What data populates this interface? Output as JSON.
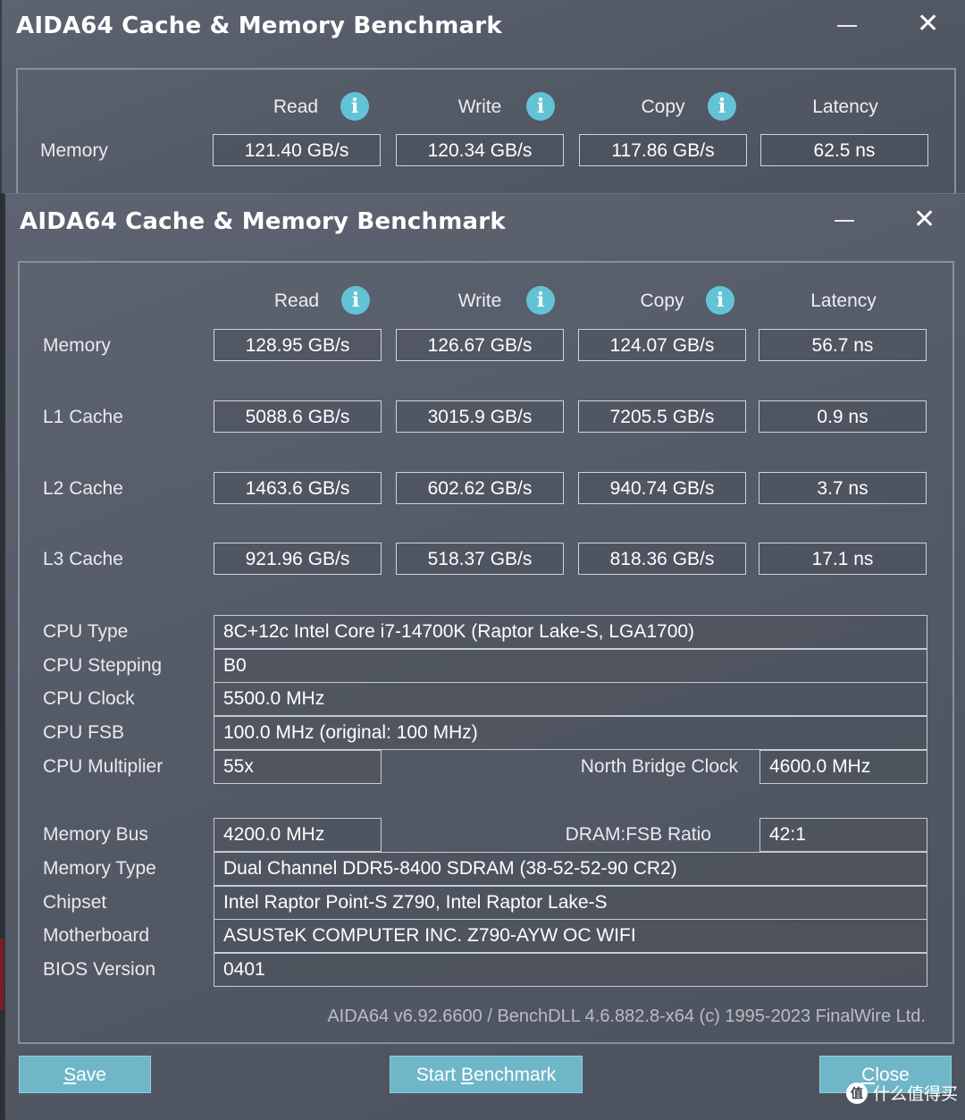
{
  "back_window": {
    "title": "AIDA64 Cache & Memory Benchmark",
    "headers": {
      "read": "Read",
      "write": "Write",
      "copy": "Copy",
      "latency": "Latency"
    },
    "memory": {
      "label": "Memory",
      "read": "121.40 GB/s",
      "write": "120.34 GB/s",
      "copy": "117.86 GB/s",
      "latency": "62.5 ns"
    }
  },
  "front_window": {
    "title": "AIDA64 Cache & Memory Benchmark",
    "headers": {
      "read": "Read",
      "write": "Write",
      "copy": "Copy",
      "latency": "Latency"
    },
    "rows": [
      {
        "label": "Memory",
        "read": "128.95 GB/s",
        "write": "126.67 GB/s",
        "copy": "124.07 GB/s",
        "latency": "56.7 ns"
      },
      {
        "label": "L1 Cache",
        "read": "5088.6 GB/s",
        "write": "3015.9 GB/s",
        "copy": "7205.5 GB/s",
        "latency": "0.9 ns"
      },
      {
        "label": "L2 Cache",
        "read": "1463.6 GB/s",
        "write": "602.62 GB/s",
        "copy": "940.74 GB/s",
        "latency": "3.7 ns"
      },
      {
        "label": "L3 Cache",
        "read": "921.96 GB/s",
        "write": "518.37 GB/s",
        "copy": "818.36 GB/s",
        "latency": "17.1 ns"
      }
    ],
    "cpu": {
      "type_label": "CPU Type",
      "type_value": "8C+12c Intel Core i7-14700K  (Raptor Lake-S, LGA1700)",
      "stepping_label": "CPU Stepping",
      "stepping_value": "B0",
      "clock_label": "CPU Clock",
      "clock_value": "5500.0 MHz",
      "fsb_label": "CPU FSB",
      "fsb_value": "100.0 MHz  (original: 100 MHz)",
      "multiplier_label": "CPU Multiplier",
      "multiplier_value": "55x",
      "nb_clock_label": "North Bridge Clock",
      "nb_clock_value": "4600.0 MHz"
    },
    "mem": {
      "bus_label": "Memory Bus",
      "bus_value": "4200.0 MHz",
      "ratio_label": "DRAM:FSB Ratio",
      "ratio_value": "42:1",
      "type_label": "Memory Type",
      "type_value": "Dual Channel DDR5-8400 SDRAM  (38-52-52-90 CR2)",
      "chipset_label": "Chipset",
      "chipset_value": "Intel Raptor Point-S Z790, Intel Raptor Lake-S",
      "motherboard_label": "Motherboard",
      "motherboard_value": "ASUSTeK COMPUTER INC. Z790-AYW OC WIFI",
      "bios_label": "BIOS Version",
      "bios_value": "0401"
    },
    "footer": "AIDA64 v6.92.6600 / BenchDLL 4.6.882.8-x64  (c) 1995-2023 FinalWire Ltd.",
    "buttons": {
      "save_underlined": "S",
      "save_rest": "ave",
      "start_pre": "Start ",
      "start_underlined": "B",
      "start_rest": "enchmark",
      "close_underlined": "C",
      "close_rest": "lose"
    }
  },
  "watermark": {
    "icon_text": "值",
    "text": "什么值得买"
  }
}
